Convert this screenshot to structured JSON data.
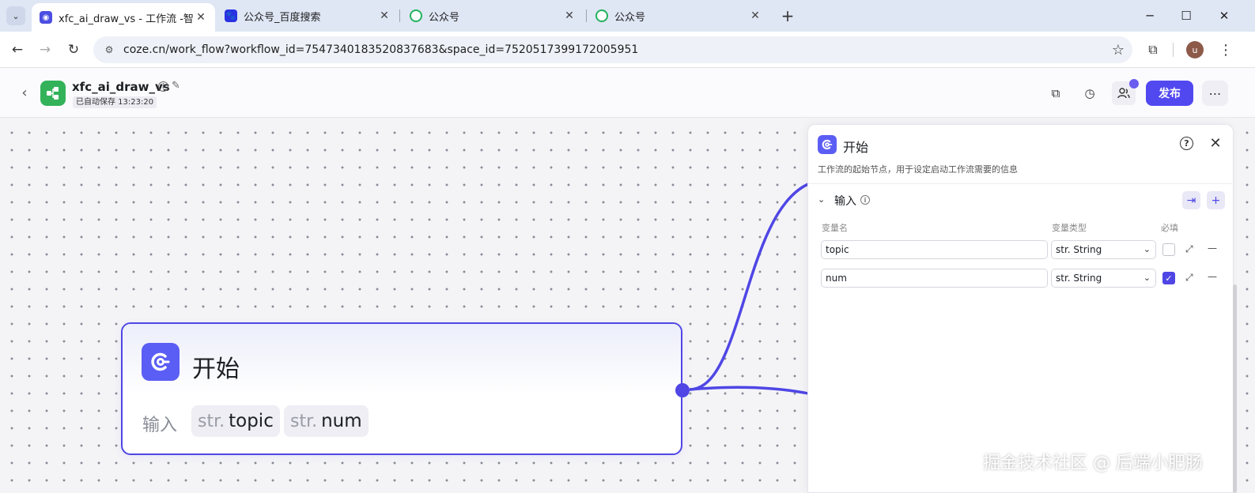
{
  "browser": {
    "tabs": [
      {
        "title": "xfc_ai_draw_vs - 工作流 -智能",
        "active": true
      },
      {
        "title": "公众号_百度搜索",
        "active": false
      },
      {
        "title": "公众号",
        "active": false
      },
      {
        "title": "公众号",
        "active": false
      }
    ],
    "url": "coze.cn/work_flow?workflow_id=7547340183520837683&space_id=7520517399172005951",
    "profile_initial": "u"
  },
  "header": {
    "app_name": "xfc_ai_draw_vs",
    "autosave": "已自动保存 13:23:20",
    "publish_label": "发布"
  },
  "node": {
    "title": "开始",
    "input_label": "输入",
    "chips": [
      {
        "type": "str.",
        "name": "topic"
      },
      {
        "type": "str.",
        "name": "num"
      }
    ]
  },
  "panel": {
    "title": "开始",
    "description": "工作流的起始节点，用于设定启动工作流需要的信息",
    "section_title": "输入",
    "columns": {
      "name": "变量名",
      "type": "变量类型",
      "required": "必填"
    },
    "rows": [
      {
        "name": "topic",
        "type": "str. String",
        "required": false
      },
      {
        "name": "num",
        "type": "str. String",
        "required": true
      }
    ]
  },
  "watermark": "掘金技术社区 @ 后端小肥肠",
  "colors": {
    "accent": "#4f46e5",
    "publish": "#5148f0",
    "logo_green": "#33b25a"
  }
}
